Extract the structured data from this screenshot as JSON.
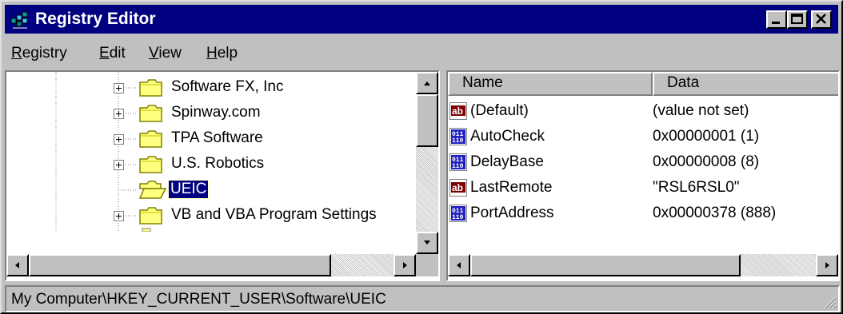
{
  "window": {
    "title": "Registry Editor",
    "app_icon": "registry-editor-icon"
  },
  "menu": [
    {
      "label": "Registry",
      "underline": "R",
      "rest": "egistry"
    },
    {
      "label": "Edit",
      "underline": "E",
      "rest": "dit"
    },
    {
      "label": "View",
      "underline": "V",
      "rest": "iew"
    },
    {
      "label": "Help",
      "underline": "H",
      "rest": "elp"
    }
  ],
  "tree": {
    "items": [
      {
        "label": "Software FX, Inc",
        "expander": "plus"
      },
      {
        "label": "Spinway.com",
        "expander": "plus"
      },
      {
        "label": "TPA Software",
        "expander": "plus"
      },
      {
        "label": "U.S. Robotics",
        "expander": "plus"
      },
      {
        "label": "UEIC",
        "expander": "none",
        "selected": true,
        "icon": "open-folder-icon"
      },
      {
        "label": "VB and VBA Program Settings",
        "expander": "plus"
      }
    ]
  },
  "values": {
    "columns": {
      "name": "Name",
      "data": "Data"
    },
    "rows": [
      {
        "icon": "string-value-icon",
        "name": "(Default)",
        "data": "(value not set)"
      },
      {
        "icon": "binary-value-icon",
        "name": "AutoCheck",
        "data": "0x00000001 (1)"
      },
      {
        "icon": "binary-value-icon",
        "name": "DelayBase",
        "data": "0x00000008 (8)"
      },
      {
        "icon": "string-value-icon",
        "name": "LastRemote",
        "data": "\"RSL6RSL0\""
      },
      {
        "icon": "binary-value-icon",
        "name": "PortAddress",
        "data": "0x00000378 (888)"
      }
    ]
  },
  "status": {
    "path": "My Computer\\HKEY_CURRENT_USER\\Software\\UEIC"
  }
}
